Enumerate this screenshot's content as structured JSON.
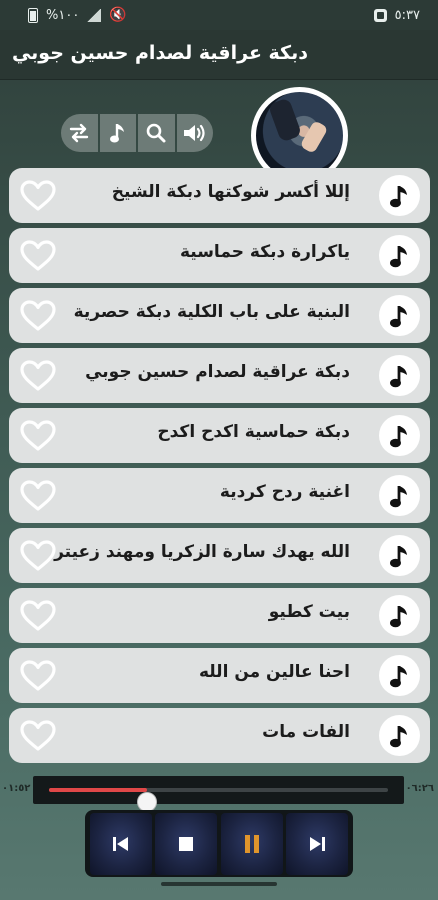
{
  "status_bar": {
    "battery_text": "%١٠٠",
    "time": "٥:٣٧"
  },
  "header": {
    "title": "دبكة عراقية لصدام حسين جوبي"
  },
  "toolbar": {
    "buttons": [
      {
        "name": "repeat-icon"
      },
      {
        "name": "music-note-icon"
      },
      {
        "name": "search-icon"
      },
      {
        "name": "volume-icon"
      }
    ]
  },
  "songs": [
    {
      "title": "إللا أكسر شوكتها دبكة الشيخ"
    },
    {
      "title": "ياكرارة دبكة حماسية"
    },
    {
      "title": "البنية على باب الكلية دبكة حصرية"
    },
    {
      "title": "دبكة عراقية لصدام حسين جوبي"
    },
    {
      "title": "دبكة حماسية اكدح اكدح"
    },
    {
      "title": "اغنية ردح كردية"
    },
    {
      "title": "الله يهدك سارة الزكريا ومهند زعيتر"
    },
    {
      "title": "بيت كطيو"
    },
    {
      "title": "احنا عالين من الله"
    },
    {
      "title": "الفات مات"
    }
  ],
  "player": {
    "elapsed": "٠١:٥٢",
    "total": "٠٦:٢٦",
    "progress_fraction": 0.29
  },
  "colors": {
    "accent_progress": "#e04848",
    "pause_icon": "#e0952c",
    "row_background": "#dfe1e1"
  }
}
